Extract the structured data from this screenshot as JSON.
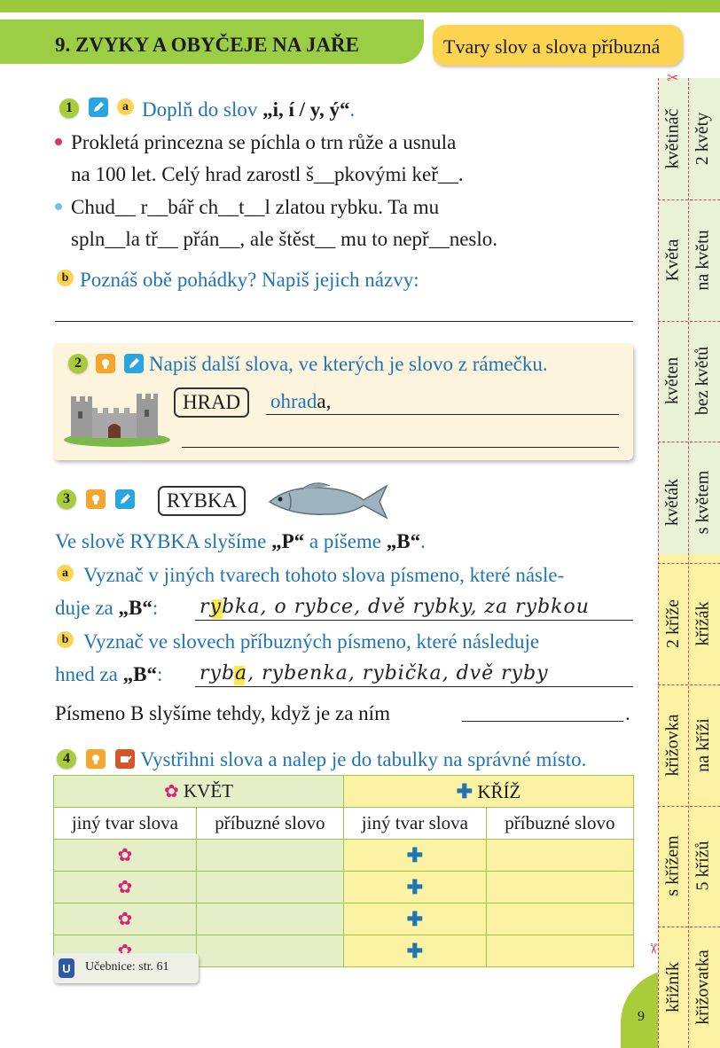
{
  "header": {
    "chapter_title": "9. ZVYKY A OBYČEJE NA JAŘE",
    "subtitle": "Tvary slov a slova příbuzná"
  },
  "ex1": {
    "number": "1",
    "sub_a": "a",
    "instruction_prefix": "Doplň do slov ",
    "instruction_bold": "„i, í / y, ý“",
    "instruction_suffix": ".",
    "bullet1_line1": "Prokletá princezna se píchla o trn růže a usnula",
    "bullet1_line2": "na 100 let. Celý hrad zarostl š__pkovými keř__.",
    "bullet2_line1": "Chud__  r__bář  ch__t__l  zlatou rybku. Ta mu",
    "bullet2_line2": "spln__la  tř__  přán__, ale štěst__  mu to nepř__neslo.",
    "sub_b": "b",
    "question_b": "Poznáš obě pohádky? Napiš jejich názvy:"
  },
  "ex2": {
    "number": "2",
    "instruction": "Napiš další slova, ve kterých je slovo z rámečku.",
    "framed_word": "HRAD",
    "example_root": "ohrad",
    "example_rest": "a,"
  },
  "ex3": {
    "number": "3",
    "framed_word": "RYBKA",
    "statement_pre": "Ve slově RYBKA slyšíme ",
    "statement_p": "„P“",
    "statement_mid": " a píšeme ",
    "statement_b": "„B“",
    "statement_end": ".",
    "sub_a": "a",
    "a_line1": "Vyznač v jiných tvarech tohoto slova písmeno, které násle-",
    "a_line2_pre": "duje za ",
    "a_line2_b": "„B“",
    "a_line2_colon": ":",
    "a_handwriting": "rybka, o rybce, dvě rybky, za rybkou",
    "sub_b": "b",
    "b_line1": "Vyznač ve slovech příbuzných písmeno, které následuje",
    "b_line2_pre": "hned za ",
    "b_line2_b": "„B“",
    "b_line2_colon": ":",
    "b_handwriting": "ryba, rybenka, rybička, dvě ryby",
    "conclusion": "Písmeno B slyšíme tehdy, když je za ním",
    "conclusion_end": "."
  },
  "ex4": {
    "number": "4",
    "instruction": "Vystřihni slova a nalep je do tabulky na správné místo.",
    "col_group_1": "KVĚT",
    "col_group_2": "KŘÍŽ",
    "sub_headers": [
      "jiný tvar slova",
      "příbuzné slovo",
      "jiný tvar slova",
      "příbuzné slovo"
    ],
    "rows": 4
  },
  "footer": {
    "badge": "U",
    "textbook_ref": "Učebnice: str. 61",
    "page_number": "9"
  },
  "cut_strip": [
    {
      "left": "květináč",
      "right": "2 květy"
    },
    {
      "left": "Květa",
      "right": "na květu"
    },
    {
      "left": "květen",
      "right": "bez květů"
    },
    {
      "left": "květák",
      "right": "s květem"
    },
    {
      "left": "2 kříže",
      "right": "křížák"
    },
    {
      "left": "křižovka",
      "right": "na kříži"
    },
    {
      "left": "s křížem",
      "right": "5 křížů"
    },
    {
      "left": "křižník",
      "right": "křižovatka"
    }
  ],
  "colors": {
    "green": "#9bcd45",
    "yellow": "#fcd451",
    "blue": "#1f74b6",
    "pink": "#d8227a"
  }
}
